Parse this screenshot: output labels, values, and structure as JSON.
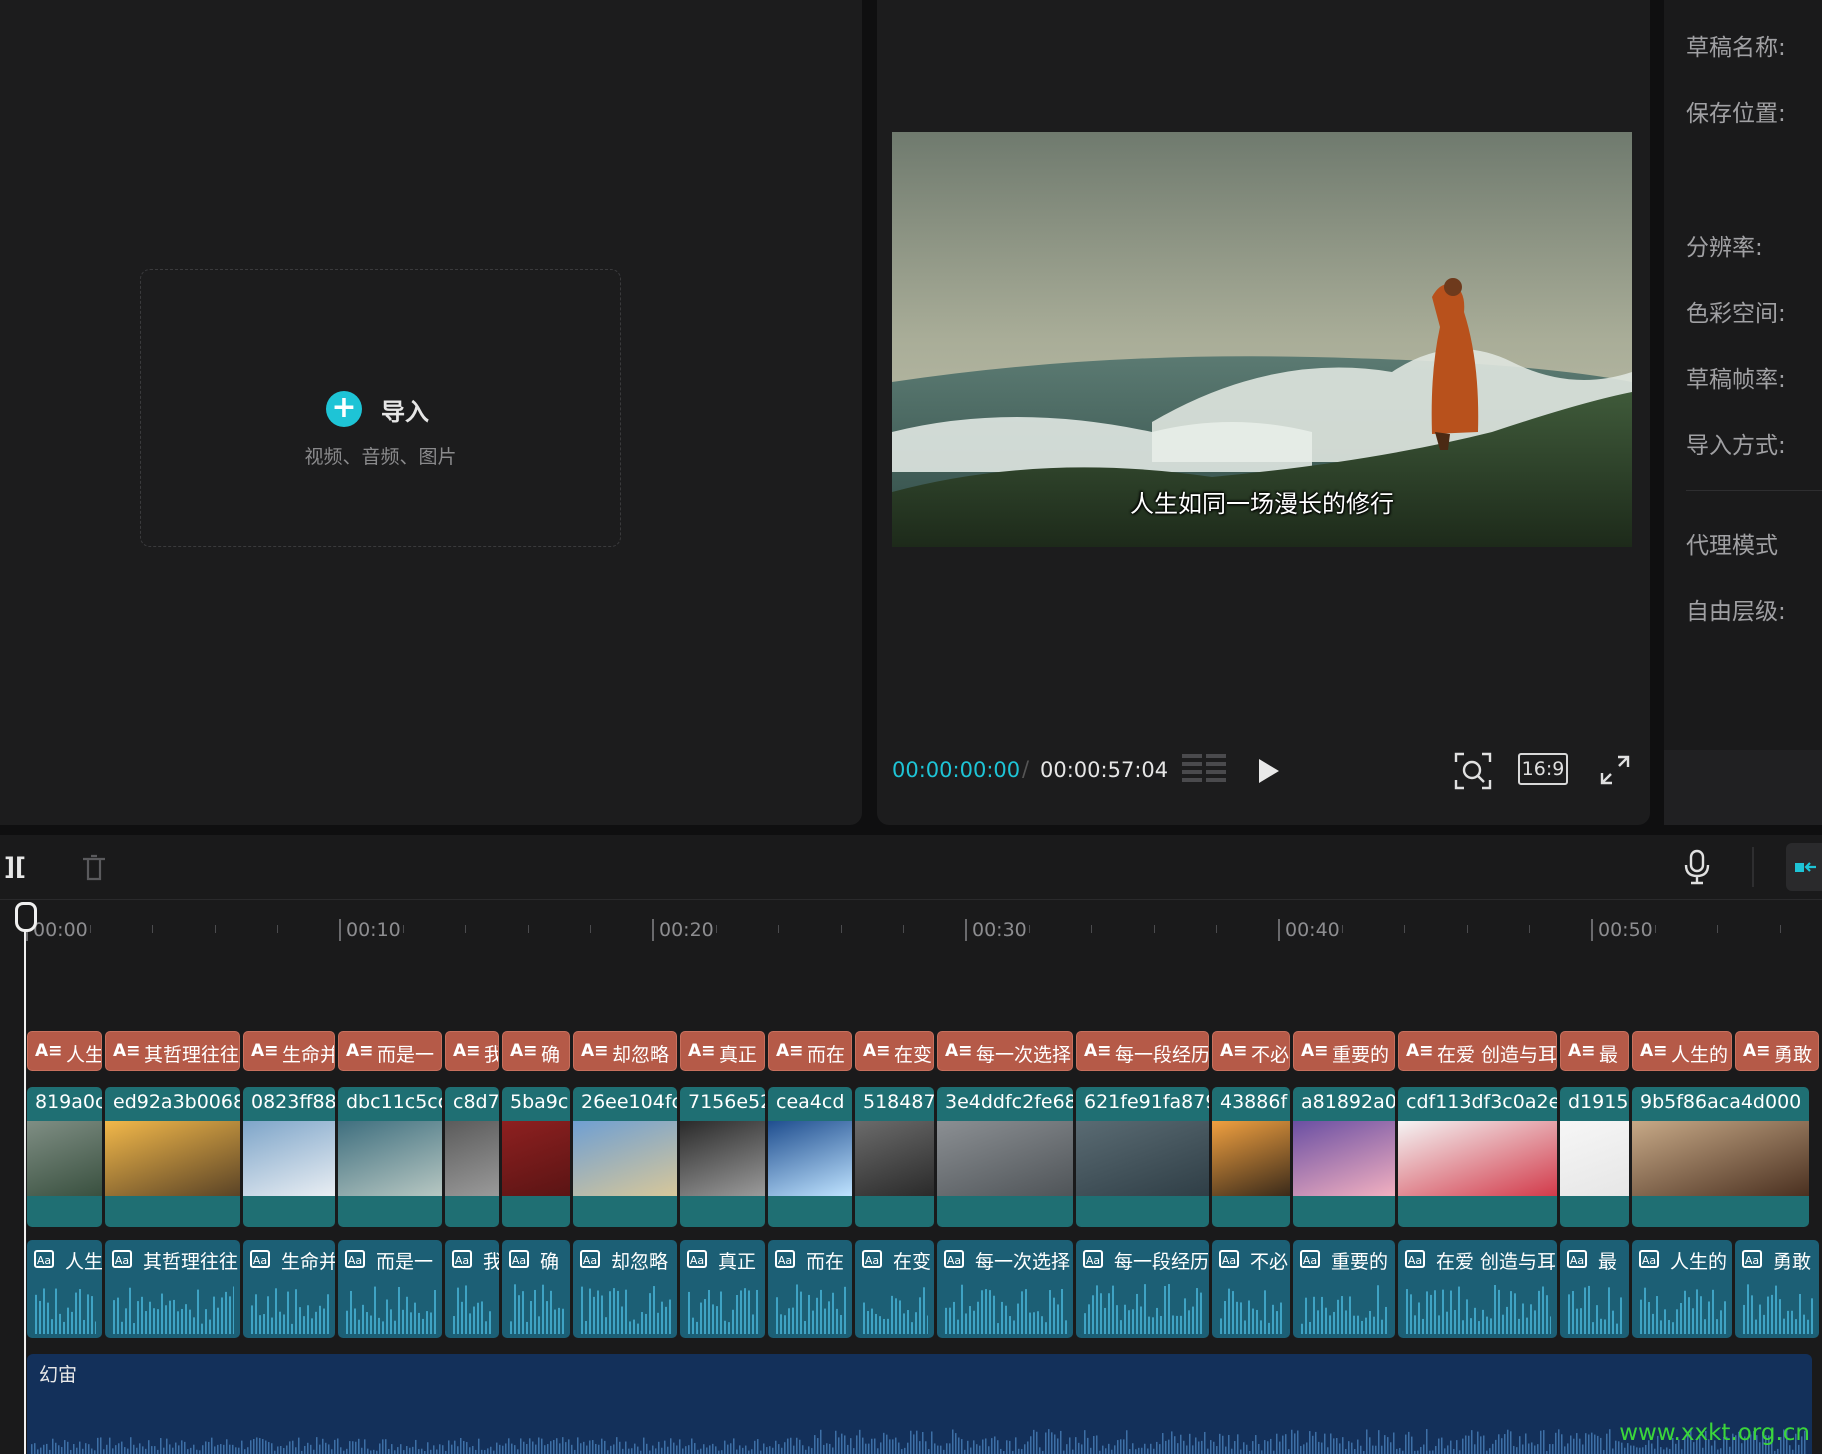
{
  "media": {
    "import_label": "导入",
    "import_hint": "视频、音频、图片"
  },
  "preview": {
    "subtitle": "人生如同一场漫长的修行",
    "timecode_current": "00:00:00:00",
    "timecode_total": "00:00:57:04",
    "ratio_label": "16:9"
  },
  "props": {
    "labels": [
      "草稿名称:",
      "保存位置:",
      "分辨率:",
      "色彩空间:",
      "草稿帧率:",
      "导入方式:",
      "代理模式",
      "自由层级:"
    ]
  },
  "timeline": {
    "ruler": [
      "00:00",
      "00:10",
      "00:20",
      "00:30",
      "00:40",
      "00:50"
    ],
    "text_clips": [
      "人生",
      "其哲理往往",
      "生命并",
      "而是一",
      "我",
      "确",
      "却忽略",
      "真正",
      "而在",
      "在变",
      "每一次选择",
      "每一段经历",
      "不必",
      "重要的",
      "在爱 创造与耳",
      "最",
      "人生的",
      "勇敢"
    ],
    "video_clips": [
      "819a0c",
      "ed92a3b0068",
      "0823ff88",
      "dbc11c5cc",
      "c8d7",
      "5ba9c",
      "26ee104fc",
      "7156e52",
      "cea4cd",
      "518487",
      "3e4ddfc2fe68",
      "621fe91fa879",
      "43886f",
      "a81892a0",
      "cdf113df3c0a2e",
      "d19159",
      "9b5f86aca4d000"
    ],
    "music_label": "幻宙"
  },
  "watermark": "www.xxkt.org.cn",
  "colors": {
    "accent": "#1ec4d6",
    "text_clip": "#b55a48",
    "video_clip": "#1f6f73",
    "audio_clip": "#1c5f75",
    "music_clip": "#13305a"
  }
}
